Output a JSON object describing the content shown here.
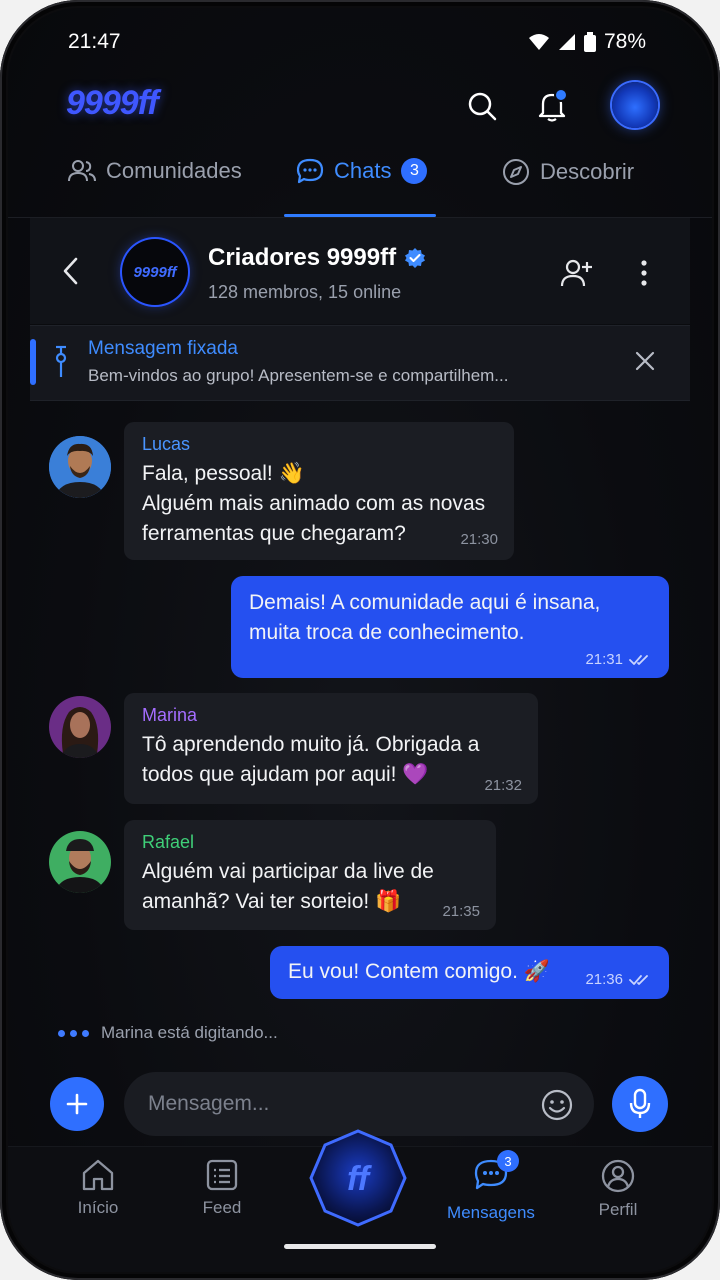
{
  "status_bar": {
    "time": "21:47",
    "battery": "78%"
  },
  "header": {
    "logo": "9999ff"
  },
  "tabs": [
    {
      "label": "Comunidades"
    },
    {
      "label": "Chats",
      "badge": "3"
    },
    {
      "label": "Descobrir"
    }
  ],
  "chat": {
    "group_avatar_text": "9999ff",
    "name": "Criadores 9999ff",
    "subtitle": "128 membros, 15 online"
  },
  "pinned": {
    "title": "Mensagem fixada",
    "text": "Bem-vindos ao grupo! Apresentem-se e compartilhem..."
  },
  "messages": [
    {
      "sender": "Lucas",
      "text": "Fala, pessoal! 👋\nAlguém mais animado com as novas ferramentas que chegaram?",
      "time": "21:30"
    },
    {
      "text": "Demais! A comunidade aqui é insana, muita troca de conhecimento.",
      "time": "21:31"
    },
    {
      "sender": "Marina",
      "text": "Tô aprendendo muito já. Obrigada a todos que ajudam por aqui! 💜",
      "time": "21:32"
    },
    {
      "sender": "Rafael",
      "text": "Alguém vai participar da live de amanhã? Vai ter sorteio! 🎁",
      "time": "21:35"
    },
    {
      "text": "Eu vou! Contem comigo. 🚀",
      "time": "21:36"
    }
  ],
  "typing": "Marina está digitando...",
  "composer": {
    "placeholder": "Mensagem..."
  },
  "bottom_nav": [
    {
      "label": "Início"
    },
    {
      "label": "Feed"
    },
    {
      "label": "ff"
    },
    {
      "label": "Mensagens",
      "badge": "3"
    },
    {
      "label": "Perfil"
    }
  ],
  "colors": {
    "accent": "#2f6fff",
    "background": "#0b0c10",
    "bubble_in": "#1b1d23",
    "bubble_out": "#2550f0"
  }
}
